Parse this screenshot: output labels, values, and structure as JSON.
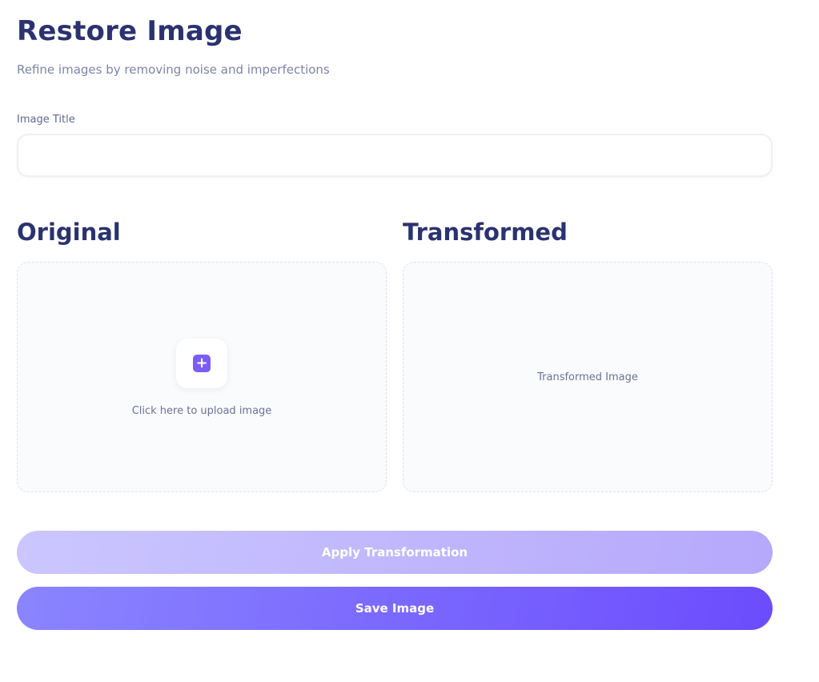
{
  "header": {
    "title": "Restore Image",
    "subtitle": "Refine images by removing noise and imperfections"
  },
  "form": {
    "title_label": "Image Title",
    "title_value": "",
    "title_placeholder": ""
  },
  "original": {
    "heading": "Original",
    "upload_icon": "plus-icon",
    "upload_text": "Click here to upload image"
  },
  "transformed": {
    "heading": "Transformed",
    "placeholder_text": "Transformed Image"
  },
  "actions": {
    "apply_label": "Apply Transformation",
    "save_label": "Save Image"
  },
  "colors": {
    "heading": "#2b3270",
    "accent": "#7b5cf5",
    "apply_button": "#bdb4fc",
    "save_button": "#7a68fe"
  }
}
